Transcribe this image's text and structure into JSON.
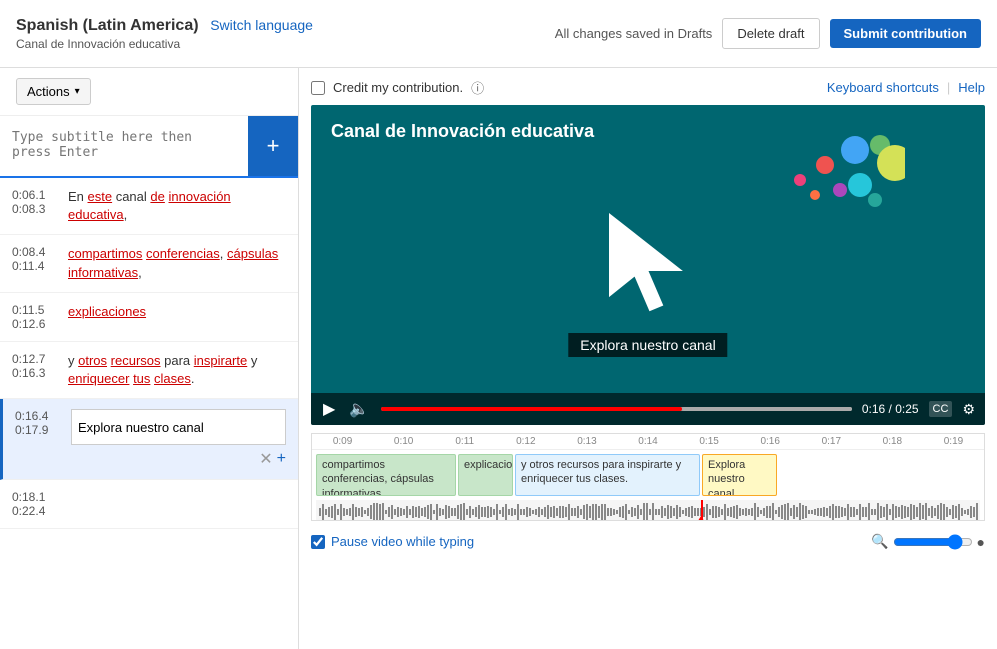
{
  "header": {
    "language": "Spanish (Latin America)",
    "switch_language": "Switch language",
    "channel": "Canal de Innovación educativa",
    "save_status": "All changes saved in Drafts",
    "delete_label": "Delete draft",
    "submit_label": "Submit contribution"
  },
  "left_panel": {
    "actions_label": "Actions",
    "input_placeholder": "Type subtitle here then press Enter",
    "subtitles": [
      {
        "id": 1,
        "start": "0:06.1",
        "end": "0:08.3",
        "text": "En este canal de innovación educativa,",
        "underlined": true
      },
      {
        "id": 2,
        "start": "0:08.4",
        "end": "0:11.4",
        "text": "compartimos conferencias, cápsulas informativas,",
        "underlined": true
      },
      {
        "id": 3,
        "start": "0:11.5",
        "end": "0:12.6",
        "text": "explicaciones",
        "underlined": true
      },
      {
        "id": 4,
        "start": "0:12.7",
        "end": "0:16.3",
        "text": "y otros recursos para inspirarte y enriquecer tus clases.",
        "underlined": true
      },
      {
        "id": 5,
        "start": "0:16.4",
        "end": "0:17.9",
        "text": "Explora nuestro canal",
        "active": true
      },
      {
        "id": 6,
        "start": "0:18.1",
        "end": "0:22.4",
        "text": "",
        "active": false
      }
    ]
  },
  "right_panel": {
    "credit_label": "Credit my contribution.",
    "keyboard_shortcuts": "Keyboard shortcuts",
    "help": "Help",
    "video_title": "Canal de Innovación educativa",
    "video_subtitle": "Explora nuestro canal",
    "time_current": "0:16",
    "time_total": "0:25",
    "timeline_times": [
      "0:09",
      "0:10",
      "0:11",
      "0:12",
      "0:13",
      "0:14",
      "0:15",
      "0:16",
      "0:17",
      "0:18",
      "0:19"
    ],
    "caption_blocks": [
      {
        "text": "compartimos conferencias, cápsulas informativas,",
        "type": "normal"
      },
      {
        "text": "explicaciones",
        "type": "normal"
      },
      {
        "text": "y otros recursos para inspirarte y enriquecer tus clases.",
        "type": "highlight"
      },
      {
        "text": "Explora nuestro canal",
        "type": "active"
      }
    ],
    "pause_label": "Pause video while typing"
  }
}
